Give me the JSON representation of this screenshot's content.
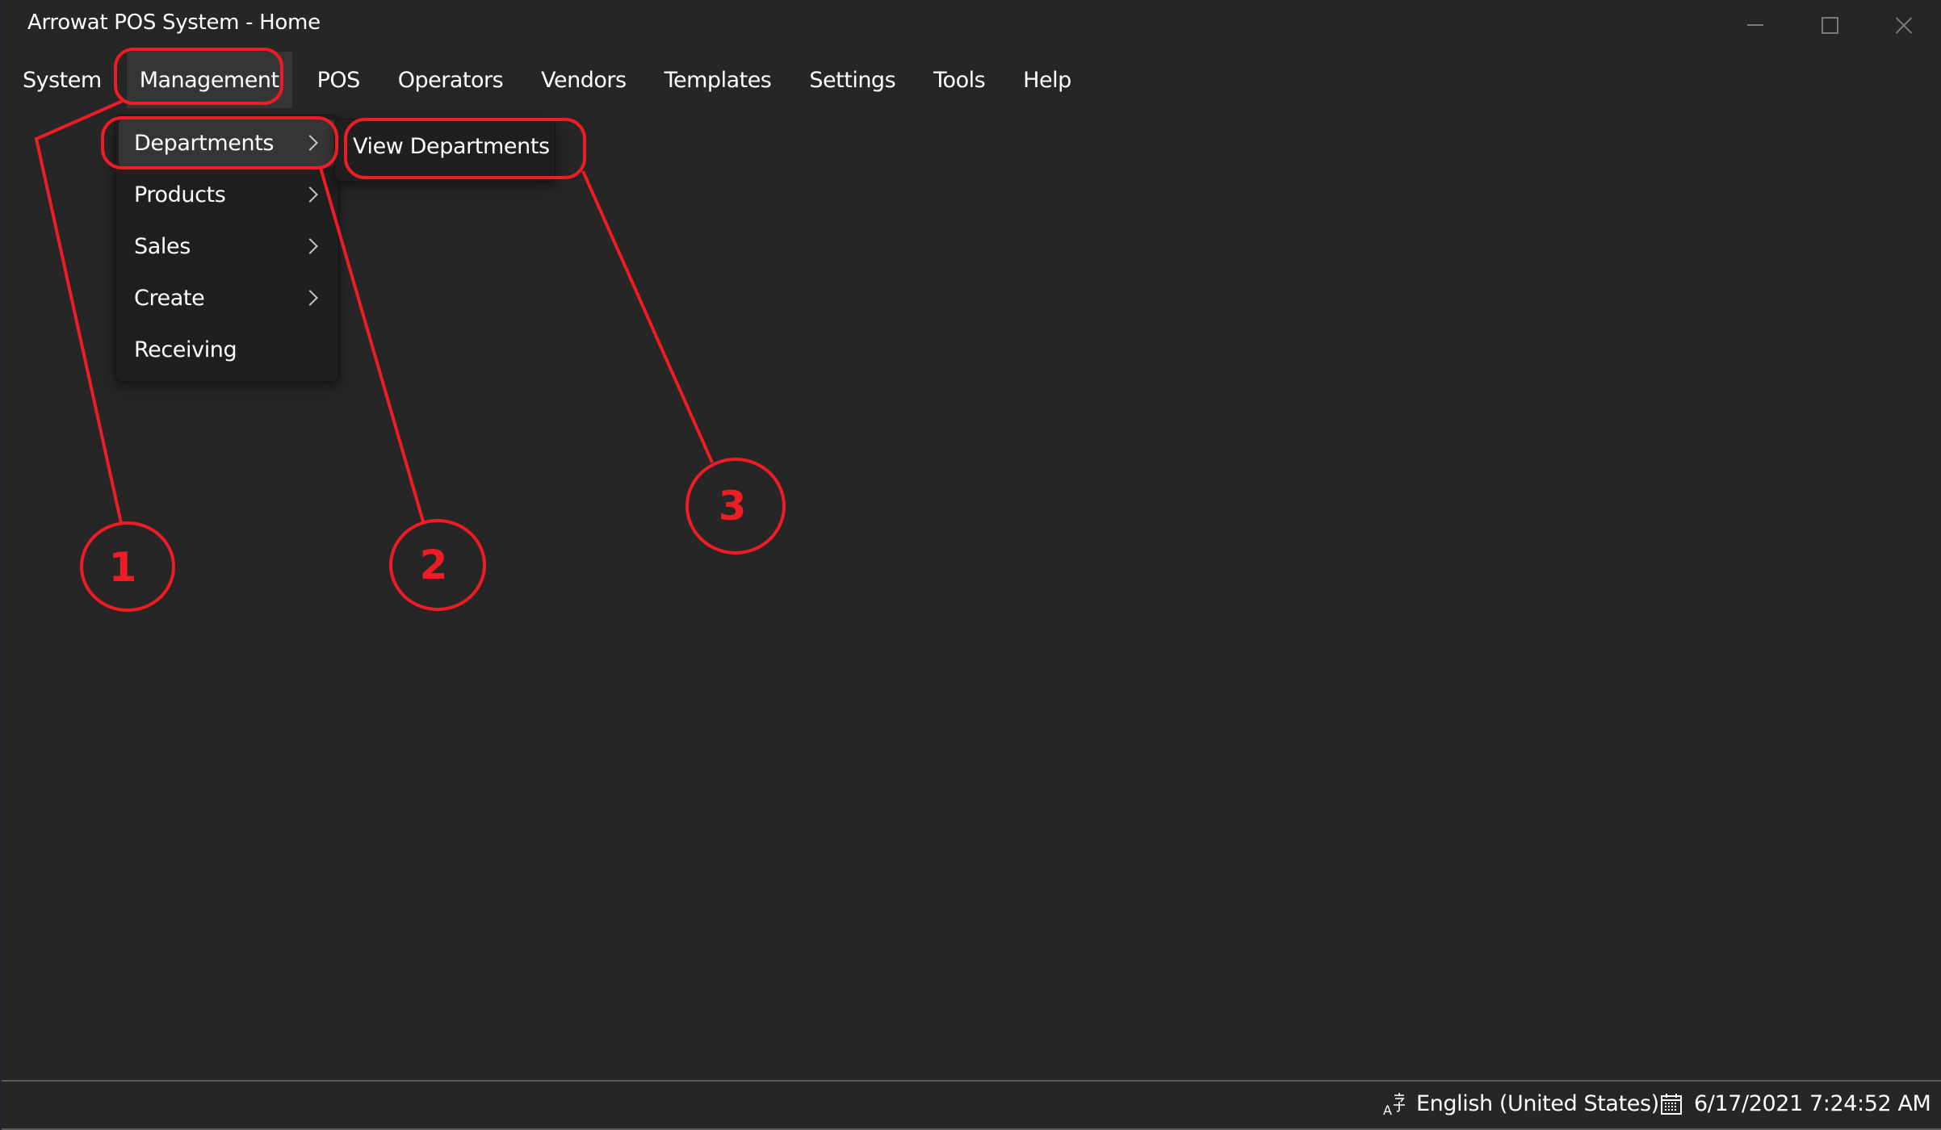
{
  "window": {
    "title": "Arrowat POS System - Home",
    "controls": [
      "minimize-icon",
      "maximize-icon",
      "close-icon"
    ]
  },
  "menu_bar": {
    "items": [
      {
        "label": "System"
      },
      {
        "label": "Management",
        "active": true
      },
      {
        "label": "POS"
      },
      {
        "label": "Operators"
      },
      {
        "label": "Vendors"
      },
      {
        "label": "Templates"
      },
      {
        "label": "Settings"
      },
      {
        "label": "Tools"
      },
      {
        "label": "Help"
      }
    ]
  },
  "management_menu": {
    "items": [
      {
        "label": "Departments",
        "has_submenu": true,
        "active": true
      },
      {
        "label": "Products",
        "has_submenu": true
      },
      {
        "label": "Sales",
        "has_submenu": true
      },
      {
        "label": "Create",
        "has_submenu": true
      },
      {
        "label": "Receiving",
        "has_submenu": false
      }
    ]
  },
  "departments_submenu": {
    "items": [
      {
        "label": "View Departments"
      }
    ]
  },
  "annotations": {
    "color": "#ee1c25",
    "steps": [
      {
        "number": "1",
        "target": "Management"
      },
      {
        "number": "2",
        "target": "Departments"
      },
      {
        "number": "3",
        "target": "View Departments"
      }
    ]
  },
  "status_bar": {
    "language_icon": "language-icon",
    "language": "English (United States)",
    "calendar_icon": "calendar-icon",
    "datetime": "6/17/2021 7:24:52 AM"
  }
}
